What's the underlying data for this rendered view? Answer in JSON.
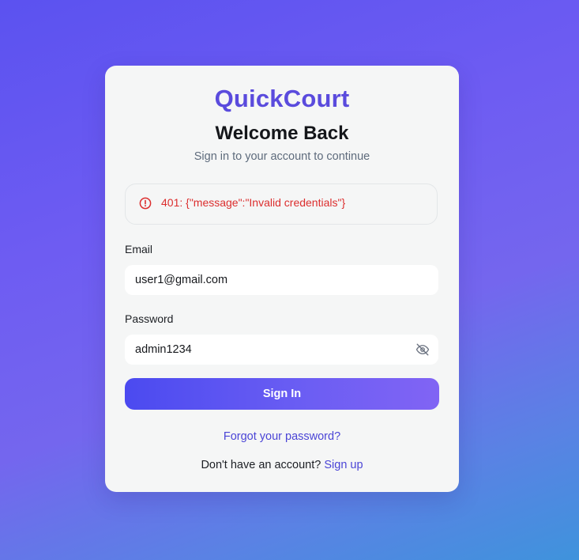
{
  "brand": {
    "name": "QuickCourt",
    "color": "#5a4bdd"
  },
  "heading": {
    "title": "Welcome Back",
    "subtitle": "Sign in to your account to continue"
  },
  "error": {
    "icon": "alert-circle-icon",
    "message": "401: {\"message\":\"Invalid credentials\"}",
    "color": "#dc2e2e"
  },
  "form": {
    "email": {
      "label": "Email",
      "value": "user1@gmail.com"
    },
    "password": {
      "label": "Password",
      "value": "admin1234",
      "toggle_icon": "eye-off-icon"
    },
    "submit_label": "Sign In"
  },
  "links": {
    "forgot": "Forgot your password?",
    "no_account_text": "Don't have an account?",
    "signup": "Sign up"
  },
  "colors": {
    "accent": "#4b45d6",
    "button_gradient_start": "#4b4af0",
    "button_gradient_end": "#8164f4"
  }
}
